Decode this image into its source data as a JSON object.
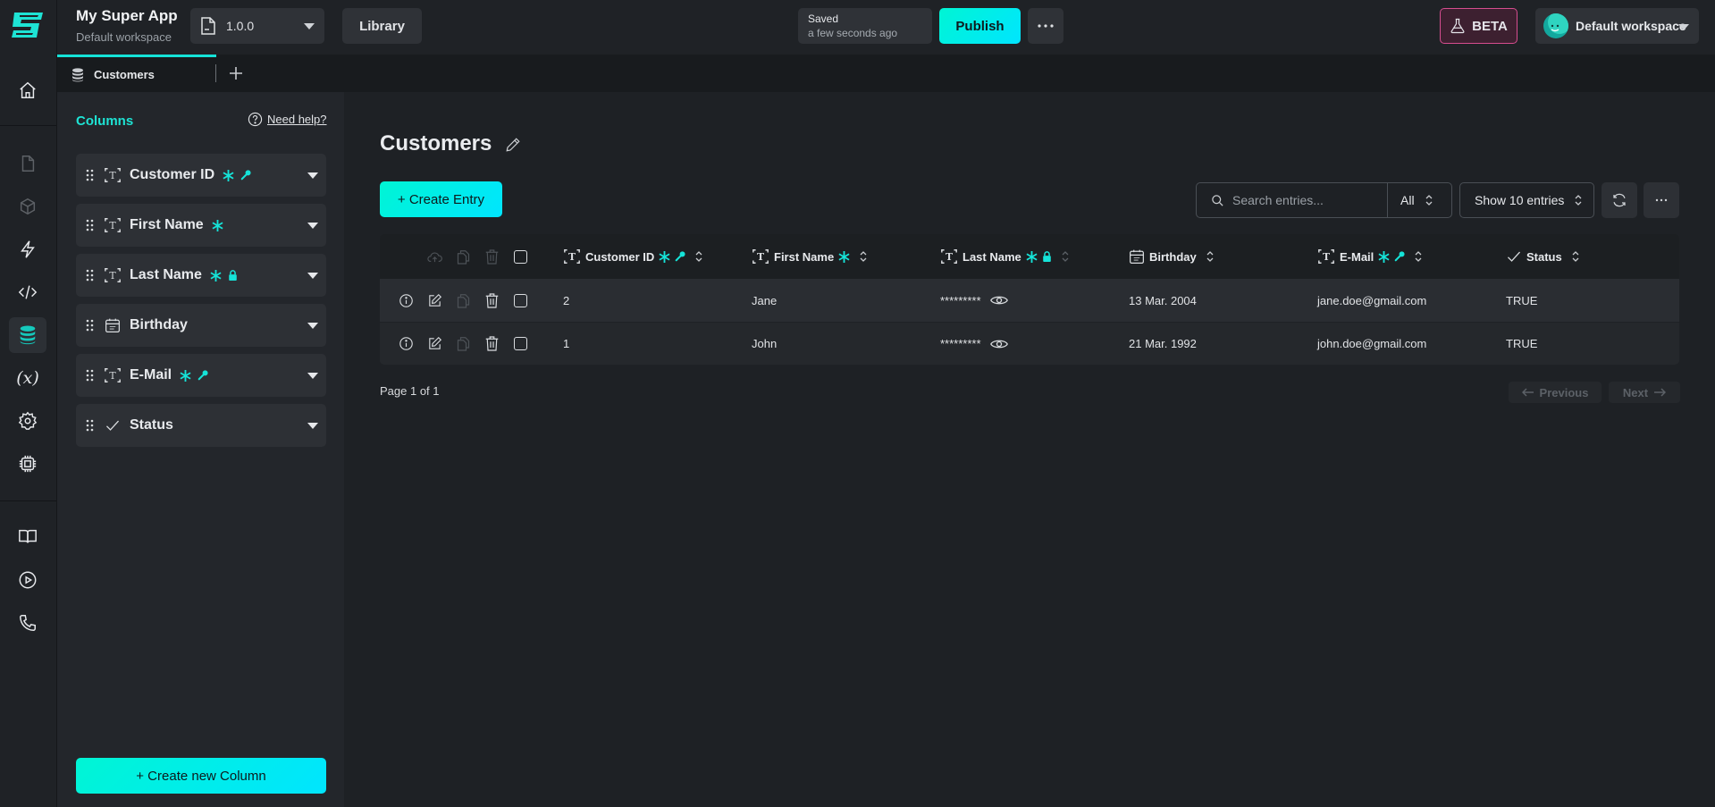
{
  "app": {
    "title": "My Super App",
    "workspace_subtitle": "Default workspace",
    "version": "1.0.0",
    "library_label": "Library",
    "saved_label": "Saved",
    "saved_time": "a few seconds ago",
    "publish_label": "Publish",
    "beta_label": "BETA",
    "workspace_label": "Default workspace"
  },
  "colors": {
    "accent": "#15e3d8",
    "beta_border": "#d64d8f"
  },
  "rail": {
    "items": [
      {
        "icon": "home-icon"
      },
      {
        "icon": "page-icon"
      },
      {
        "icon": "cube-icon"
      },
      {
        "icon": "lightning-icon"
      },
      {
        "icon": "code-icon"
      },
      {
        "icon": "database-icon",
        "active": true
      },
      {
        "icon": "variable-icon"
      },
      {
        "icon": "gear-icon"
      },
      {
        "icon": "chip-icon"
      },
      {
        "icon": "book-icon"
      },
      {
        "icon": "play-icon"
      },
      {
        "icon": "phone-icon"
      }
    ]
  },
  "tabs": [
    {
      "label": "Customers",
      "active": true
    }
  ],
  "columns_panel": {
    "title": "Columns",
    "help_label": "Need help?",
    "items": [
      {
        "name": "Customer ID",
        "type": "text",
        "required": true,
        "key": true,
        "locked": false
      },
      {
        "name": "First Name",
        "type": "text",
        "required": true,
        "key": false,
        "locked": false
      },
      {
        "name": "Last Name",
        "type": "text",
        "required": true,
        "key": false,
        "locked": true
      },
      {
        "name": "Birthday",
        "type": "date",
        "required": false,
        "key": false,
        "locked": false
      },
      {
        "name": "E-Mail",
        "type": "text",
        "required": true,
        "key": true,
        "locked": false
      },
      {
        "name": "Status",
        "type": "boolean",
        "required": false,
        "key": false,
        "locked": false
      }
    ],
    "create_label": "+ Create new Column"
  },
  "main": {
    "title": "Customers",
    "create_entry_label": "+ Create Entry",
    "search_placeholder": "Search entries...",
    "filter_value": "All",
    "page_size_value": "Show 10 entries",
    "table": {
      "headers": [
        "Customer ID",
        "First Name",
        "Last Name",
        "Birthday",
        "E-Mail",
        "Status"
      ],
      "rows": [
        {
          "customer_id": "2",
          "first_name": "Jane",
          "last_name": "*********",
          "birthday": "13 Mar. 2004",
          "email": "jane.doe@gmail.com",
          "status": "TRUE"
        },
        {
          "customer_id": "1",
          "first_name": "John",
          "last_name": "*********",
          "birthday": "21 Mar. 1992",
          "email": "john.doe@gmail.com",
          "status": "TRUE"
        }
      ]
    },
    "pagination": {
      "text": "Page 1 of 1",
      "previous_label": "Previous",
      "next_label": "Next"
    }
  }
}
